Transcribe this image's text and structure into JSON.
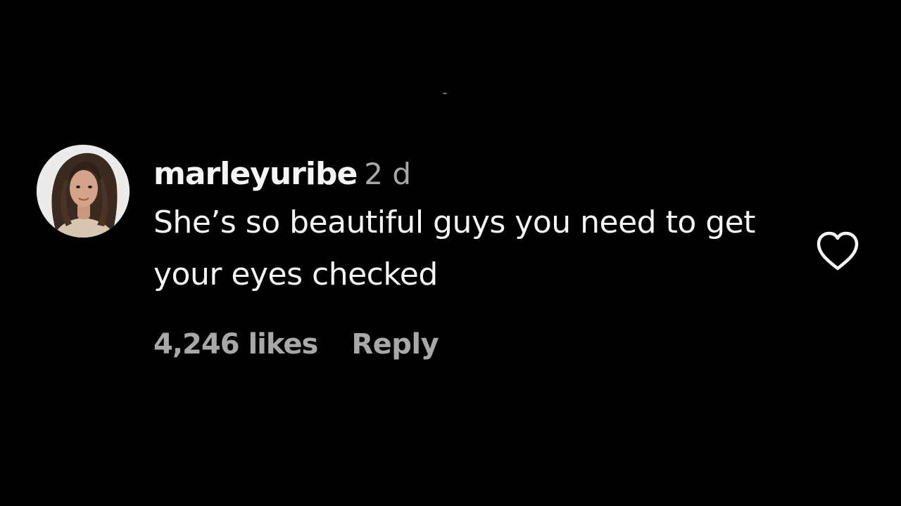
{
  "comment": {
    "avatar_icon": "profile-photo",
    "username": "marleyuribe",
    "timestamp": "2 d",
    "text": "She’s so beautiful guys you need to get your eyes checked",
    "likes": "4,246 likes",
    "reply_label": "Reply",
    "like_icon": "heart-outline-icon"
  },
  "colors": {
    "background": "#000000",
    "primary_text": "#f5f5f5",
    "secondary_text": "#a8a8a8"
  }
}
